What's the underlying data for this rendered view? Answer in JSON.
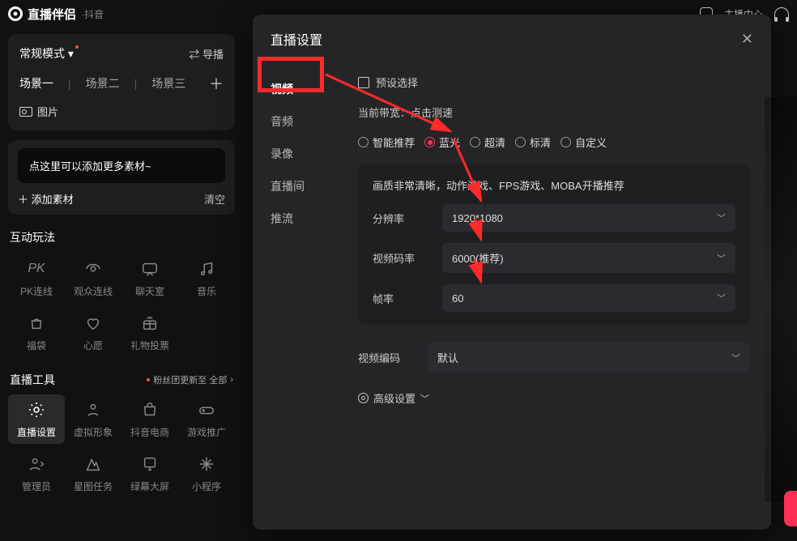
{
  "app": {
    "title": "直播伴侣",
    "sub": "·抖音",
    "host_center": "主播中心"
  },
  "scenes": {
    "mode": "常规模式",
    "daobo": "导播",
    "tabs": [
      "场景一",
      "场景二",
      "场景三"
    ],
    "image": "图片",
    "tip": "点这里可以添加更多素材~",
    "add": "添加素材",
    "clear": "清空"
  },
  "interaction": {
    "title": "互动玩法",
    "items": [
      "PK连线",
      "观众连线",
      "聊天室",
      "音乐",
      "福袋",
      "心愿",
      "礼物投票"
    ]
  },
  "tools": {
    "title": "直播工具",
    "fans_text": "粉丝团更新至 全部",
    "items": [
      "直播设置",
      "虚拟形象",
      "抖音电商",
      "游戏推广",
      "管理员",
      "星图任务",
      "绿幕大屏",
      "小程序"
    ]
  },
  "modal": {
    "title": "直播设置",
    "nav": [
      "视频",
      "音频",
      "录像",
      "直播间",
      "推流"
    ],
    "preset": "预设选择",
    "bandwidth_label": "当前带宽：",
    "bandwidth_action": "点击测速",
    "quality_options": [
      "智能推荐",
      "蓝光",
      "超清",
      "标清",
      "自定义"
    ],
    "quality_selected": "蓝光",
    "quality_desc": "画质非常清晰，动作游戏、FPS游戏、MOBA开播推荐",
    "resolution_label": "分辨率",
    "resolution_value": "1920*1080",
    "bitrate_label": "视频码率",
    "bitrate_value": "6000(推荐)",
    "fps_label": "帧率",
    "fps_value": "60",
    "encode_label": "视频编码",
    "encode_value": "默认",
    "advanced": "高级设置"
  },
  "chart_data": null
}
